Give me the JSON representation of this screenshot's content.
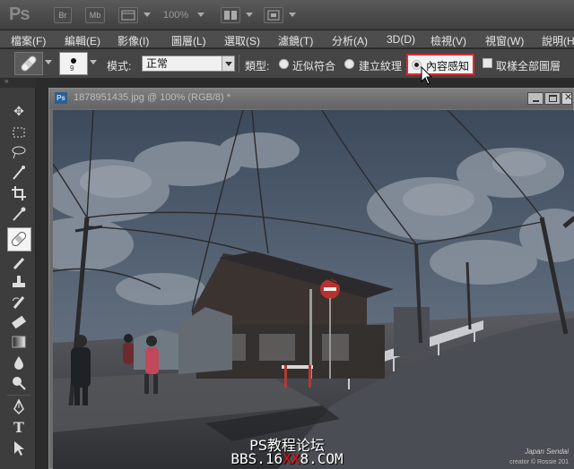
{
  "appbar": {
    "logo": "Ps",
    "br_label": "Br",
    "mb_label": "Mb",
    "zoom": "100%"
  },
  "menu": {
    "items": [
      "檔案(F)",
      "編輯(E)",
      "影像(I)",
      "圖層(L)",
      "選取(S)",
      "濾鏡(T)",
      "分析(A)",
      "3D(D)",
      "檢視(V)",
      "視窗(W)",
      "說明(H)"
    ]
  },
  "options": {
    "brush_size": "9",
    "mode_label": "模式:",
    "mode_value": "正常",
    "type_label": "類型:",
    "radio_proximity": "近似符合",
    "radio_texture": "建立紋理",
    "radio_content_aware": "內容感知",
    "sample_all_layers": "取樣全部圖層",
    "selected_type": "內容感知"
  },
  "document": {
    "title": "1878951435.jpg @ 100% (RGB/8) *"
  },
  "watermark": {
    "line1": "PS教程论坛",
    "line2_pre": "BBS.16",
    "line2_red": "XX",
    "line2_post": "8.COM"
  },
  "photo_credit": {
    "line1": "Japan Sendai",
    "line2": "creator © Rossie 201"
  },
  "colors": {
    "highlight": "#e0282f",
    "watermark_red": "#e11111"
  },
  "icons": [
    "move-tool-icon",
    "marquee-tool-icon",
    "lasso-tool-icon",
    "quick-selection-tool-icon",
    "crop-tool-icon",
    "eyedropper-tool-icon",
    "spot-healing-brush-tool-icon",
    "brush-tool-icon",
    "clone-stamp-tool-icon",
    "history-brush-tool-icon",
    "eraser-tool-icon",
    "gradient-tool-icon",
    "blur-tool-icon",
    "dodge-tool-icon",
    "pen-tool-icon",
    "type-tool-icon",
    "path-selection-tool-icon"
  ]
}
